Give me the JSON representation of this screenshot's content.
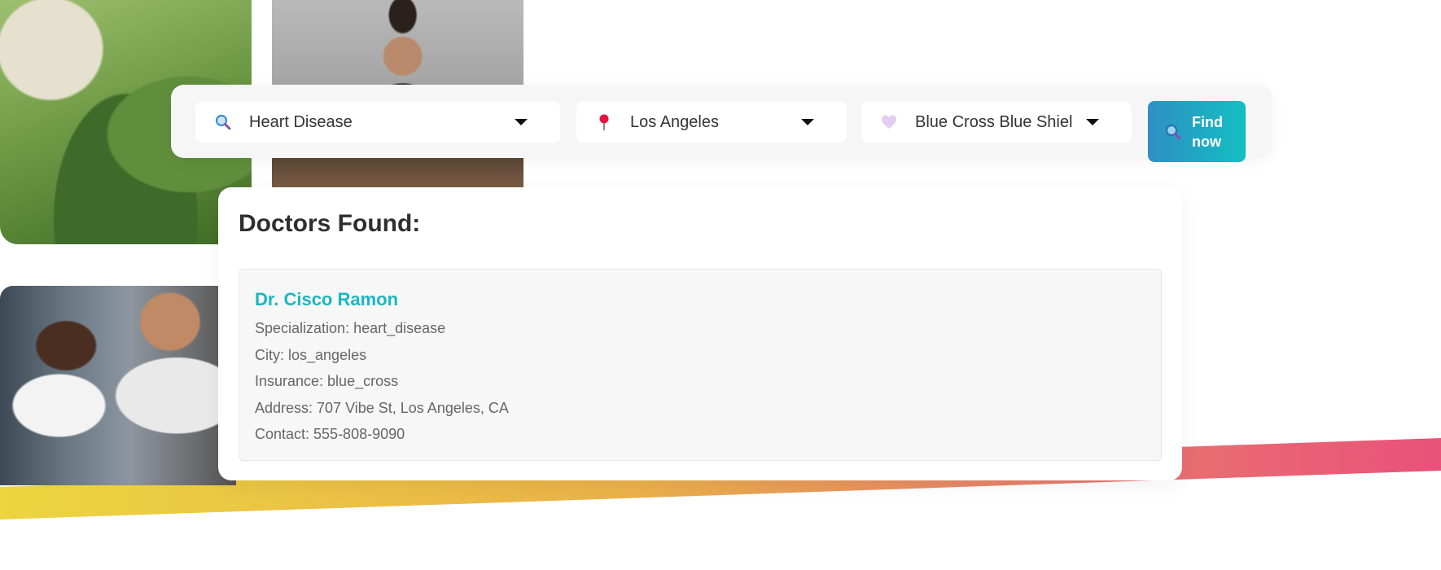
{
  "search": {
    "condition_value": "Heart Disease",
    "city_value": "Los Angeles",
    "insurance_value": "Blue Cross Blue Shiel",
    "find_label": "Find now"
  },
  "results": {
    "title": "Doctors Found:",
    "doctors": [
      {
        "name": "Dr. Cisco Ramon",
        "specialization": "Specialization: heart_disease",
        "city": "City: los_angeles",
        "insurance": "Insurance: blue_cross",
        "address": "Address: 707 Vibe St, Los Angeles, CA",
        "contact": "Contact: 555-808-9090"
      }
    ]
  },
  "colors": {
    "accent_teal": "#19b7c2",
    "button_gradient_start": "#2f8fc6",
    "button_gradient_end": "#13bfc0",
    "band_yellow": "#ecd53f",
    "band_pink": "#e9517a"
  },
  "icons": {
    "condition": "magnifier-icon",
    "city": "pushpin-icon",
    "insurance": "heart-icon",
    "find": "magnifier-icon"
  }
}
